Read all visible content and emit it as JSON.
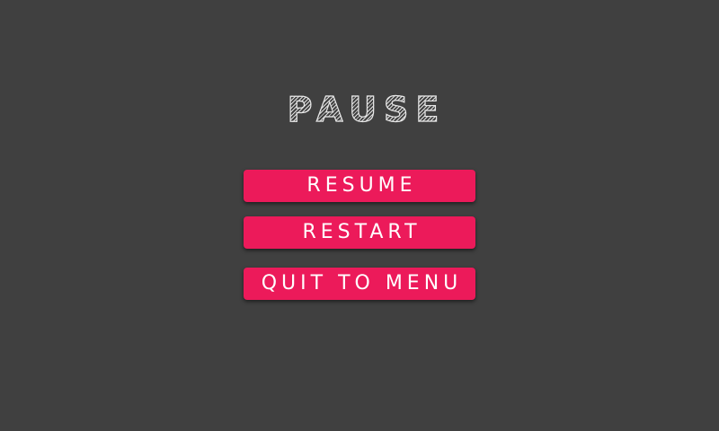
{
  "pause_menu": {
    "title": "PAUSE",
    "buttons": {
      "resume": "RESUME",
      "restart": "RESTART",
      "quit": "QUIT TO MENU"
    }
  },
  "colors": {
    "background": "#404040",
    "button": "#ec1a5a",
    "text": "#ffffff"
  }
}
